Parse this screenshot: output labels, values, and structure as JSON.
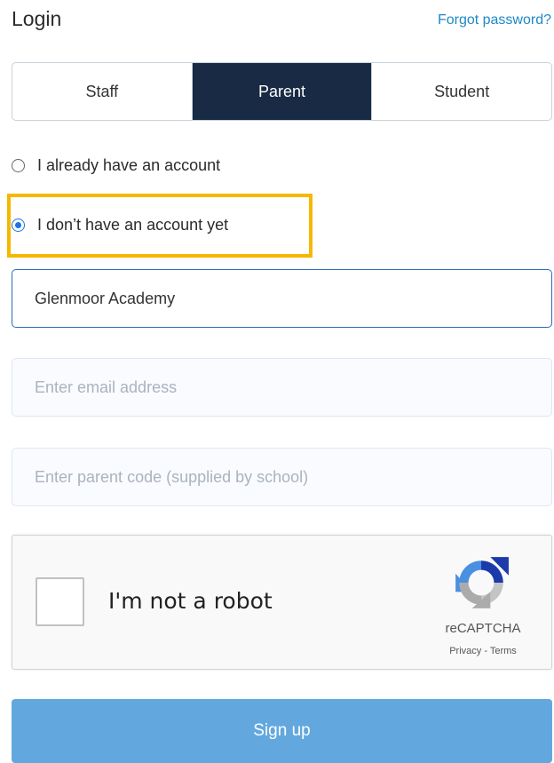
{
  "header": {
    "title": "Login",
    "forgot_link": "Forgot password?"
  },
  "tabs": [
    {
      "label": "Staff",
      "active": false
    },
    {
      "label": "Parent",
      "active": true
    },
    {
      "label": "Student",
      "active": false
    }
  ],
  "account_options": [
    {
      "label": "I already have an account",
      "selected": false
    },
    {
      "label": "I don’t have an account yet",
      "selected": true
    }
  ],
  "form": {
    "school_value": "Glenmoor Academy",
    "email_placeholder": "Enter email address",
    "parent_code_placeholder": "Enter parent code (supplied by school)"
  },
  "captcha": {
    "label": "I'm not a robot",
    "brand": "reCAPTCHA",
    "links": "Privacy - Terms"
  },
  "signup_label": "Sign up",
  "colors": {
    "primary_dark": "#182a44",
    "link": "#1e88c7",
    "button": "#62a8de",
    "highlight": "#f5b800"
  }
}
